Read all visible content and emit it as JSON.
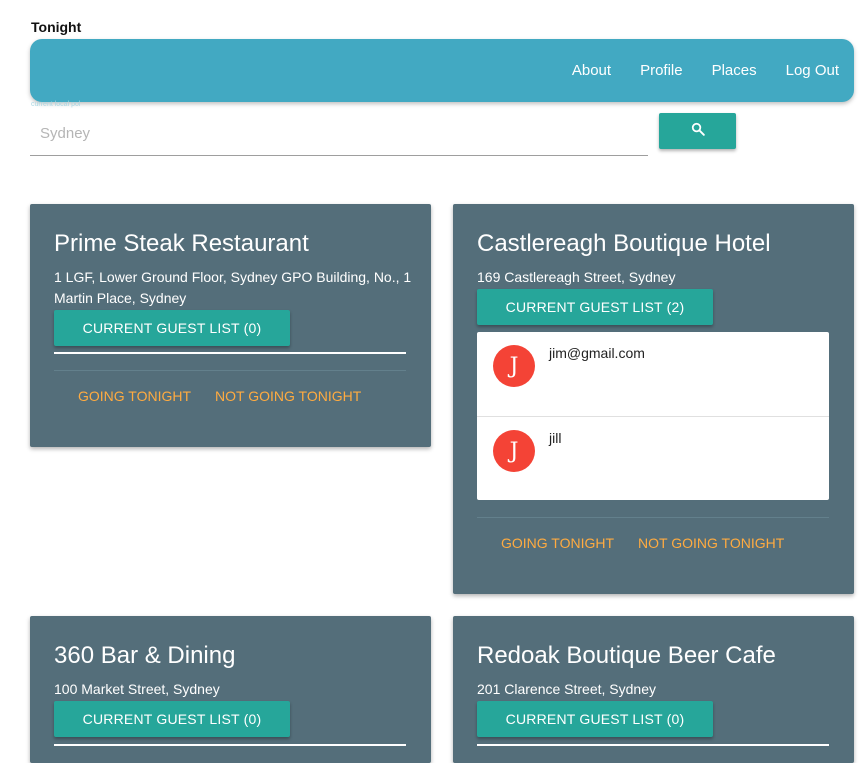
{
  "brand": "Tonight",
  "nav": [
    "About",
    "Profile",
    "Places",
    "Log Out"
  ],
  "search": {
    "label": "current local pol",
    "value": "",
    "placeholder": "Sydney"
  },
  "icons": {
    "search": "search-icon"
  },
  "colors": {
    "navbar": "#42a9c2",
    "card": "#546e7a",
    "primary_button": "#26a69a",
    "action_link": "#ffab40",
    "avatar": "#f44336"
  },
  "cards": [
    {
      "title": "Prime Steak Restaurant",
      "address": "1 LGF, Lower Ground Floor, Sydney GPO Building, No., 1 Martin Place, Sydney",
      "guest_button": "CURRENT GUEST LIST (0)",
      "going": "GOING TONIGHT",
      "not_going": "NOT GOING TONIGHT"
    },
    {
      "title": "Castlereagh Boutique Hotel",
      "address": "169 Castlereagh Street, Sydney",
      "guest_button": "CURRENT GUEST LIST (2)",
      "guests": [
        {
          "initial": "J",
          "name": "jim@gmail.com"
        },
        {
          "initial": "J",
          "name": "jill"
        }
      ],
      "going": "GOING TONIGHT",
      "not_going": "NOT GOING TONIGHT"
    },
    {
      "title": "360 Bar & Dining",
      "address": "100 Market Street, Sydney",
      "guest_button": "CURRENT GUEST LIST (0)"
    },
    {
      "title": "Redoak Boutique Beer Cafe",
      "address": "201 Clarence Street, Sydney",
      "guest_button": "CURRENT GUEST LIST (0)"
    }
  ]
}
